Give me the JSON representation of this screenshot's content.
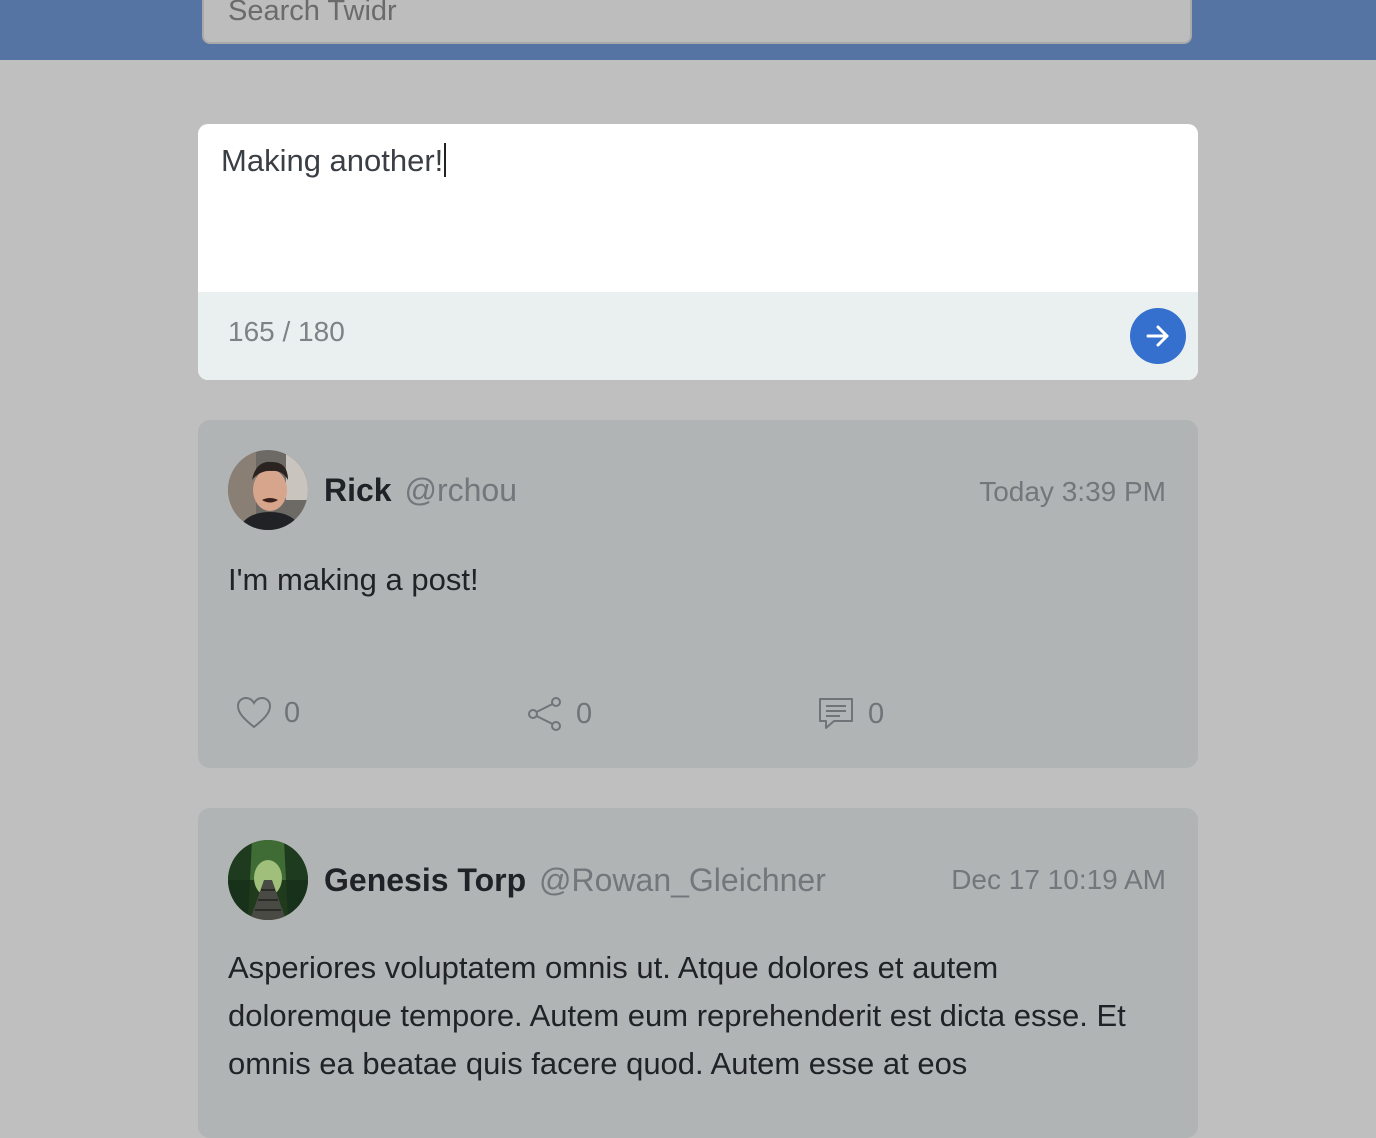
{
  "search": {
    "placeholder": "Search Twidr"
  },
  "composer": {
    "text": "Making another!",
    "counter": "165 / 180"
  },
  "posts": [
    {
      "name": "Rick",
      "handle": "@rchou",
      "time": "Today 3:39 PM",
      "body": "I'm making a post!",
      "likes": "0",
      "shares": "0",
      "comments": "0"
    },
    {
      "name": "Genesis Torp",
      "handle": "@Rowan_Gleichner",
      "time": "Dec 17 10:19 AM",
      "body": "Asperiores voluptatem omnis ut. Atque dolores et autem doloremque tempore. Autem eum reprehenderit est dicta esse. Et omnis ea beatae quis facere quod. Autem esse at eos"
    }
  ],
  "colors": {
    "header": "#5574a3",
    "accent": "#3570ce",
    "background": "#bfbfbf"
  },
  "icons": [
    "arrow-right-icon",
    "heart-icon",
    "share-icon",
    "comment-icon"
  ]
}
